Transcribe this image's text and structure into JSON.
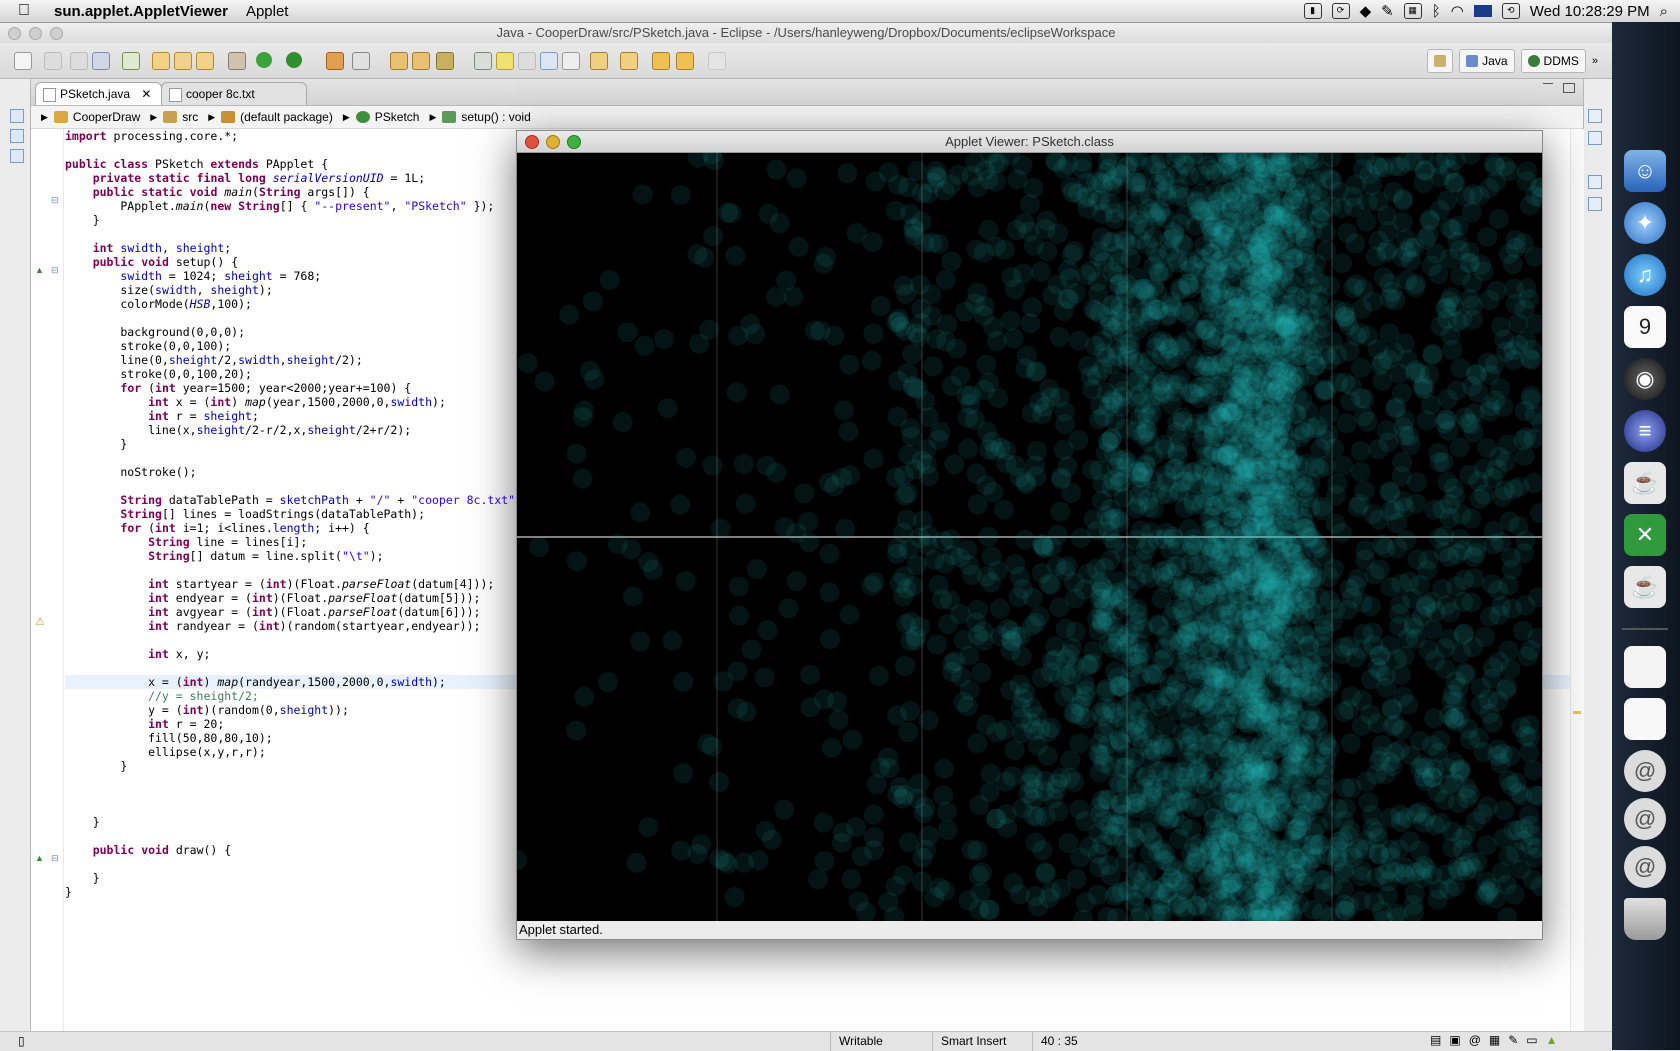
{
  "menubar": {
    "app_name": "sun.applet.AppletViewer",
    "menus": [
      "Applet"
    ],
    "clock": "Wed 10:28:29 PM"
  },
  "eclipse": {
    "title": "Java - CooperDraw/src/PSketch.java - Eclipse - /Users/hanleyweng/Dropbox/Documents/eclipseWorkspace",
    "perspectives": [
      "Java",
      "DDMS"
    ],
    "tabs": [
      {
        "label": "PSketch.java",
        "active": true
      },
      {
        "label": "cooper 8c.txt",
        "active": false
      }
    ],
    "breadcrumb": [
      "CooperDraw",
      "src",
      "(default package)",
      "PSketch",
      "setup() : void"
    ],
    "status": {
      "mode": "Writable",
      "insert": "Smart Insert",
      "position": "40 : 35"
    }
  },
  "code_lines": [
    "import processing.core.*;",
    "",
    "public class PSketch extends PApplet {",
    "    private static final long serialVersionUID = 1L;",
    "    public static void main(String args[]) {",
    "        PApplet.main(new String[] { \"--present\", \"PSketch\" });",
    "    }",
    "",
    "    int swidth, sheight;",
    "    public void setup() {",
    "        swidth = 1024; sheight = 768;",
    "        size(swidth, sheight);",
    "        colorMode(HSB,100);",
    "",
    "        background(0,0,0);",
    "        stroke(0,0,100);",
    "        line(0,sheight/2,swidth,sheight/2);",
    "        stroke(0,0,100,20);",
    "        for (int year=1500; year<2000;year+=100) {",
    "            int x = (int) map(year,1500,2000,0,swidth);",
    "            int r = sheight;",
    "            line(x,sheight/2-r/2,x,sheight/2+r/2);",
    "        }",
    "",
    "        noStroke();",
    "",
    "        String dataTablePath = sketchPath + \"/\" + \"cooper 8c.txt\";",
    "        String[] lines = loadStrings(dataTablePath);",
    "        for (int i=1; i<lines.length; i++) {",
    "            String line = lines[i];",
    "            String[] datum = line.split(\"\\t\");",
    "",
    "            int startyear = (int)(Float.parseFloat(datum[4]));",
    "            int endyear = (int)(Float.parseFloat(datum[5]));",
    "            int avgyear = (int)(Float.parseFloat(datum[6]));",
    "            int randyear = (int)(random(startyear,endyear));",
    "",
    "            int x, y;",
    "",
    "            x = (int) map(randyear,1500,2000,0,swidth);",
    "            //y = sheight/2;",
    "            y = (int)(random(0,sheight));",
    "            int r = 20;",
    "            fill(50,80,80,10);",
    "            ellipse(x,y,r,r);",
    "        }",
    "",
    "",
    "",
    "    }",
    "",
    "    public void draw() {",
    "",
    "    }",
    "}"
  ],
  "applet": {
    "title": "Applet Viewer: PSketch.class",
    "status": "Applet started.",
    "circle_color": "#27c9c9"
  },
  "dock_icons": [
    "finder-icon",
    "safari-icon",
    "itunes-icon",
    "ical-icon",
    "photo-booth-icon",
    "eclipse-icon",
    "java-cup-icon",
    "excel-icon",
    "java-cup-icon",
    "document-icon",
    "document-icon",
    "mail-icon",
    "mail-icon",
    "mail-icon",
    "trash-icon"
  ]
}
